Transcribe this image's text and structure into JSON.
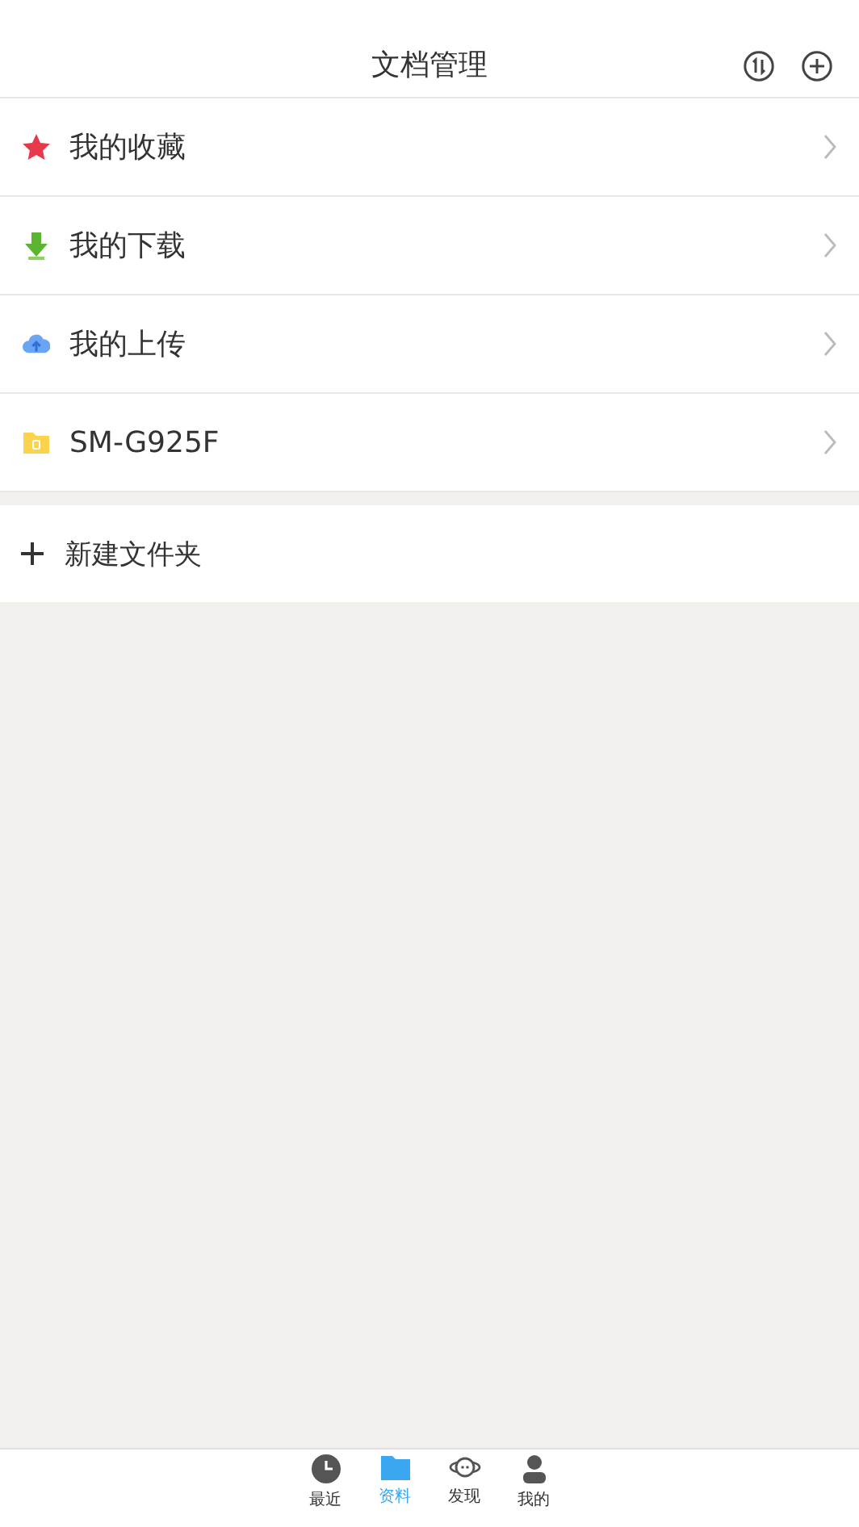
{
  "header": {
    "title": "文档管理"
  },
  "items": [
    {
      "kind": "star",
      "label": "我的收藏"
    },
    {
      "kind": "download",
      "label": "我的下载"
    },
    {
      "kind": "upload",
      "label": "我的上传"
    },
    {
      "kind": "device",
      "label": "SM-G925F"
    }
  ],
  "new_folder": {
    "label": "新建文件夹"
  },
  "tabs": [
    {
      "kind": "clock",
      "label": "最近",
      "selected": false
    },
    {
      "kind": "folder",
      "label": "资料",
      "selected": true
    },
    {
      "kind": "planet",
      "label": "发现",
      "selected": false
    },
    {
      "kind": "person",
      "label": "我的",
      "selected": false
    }
  ]
}
